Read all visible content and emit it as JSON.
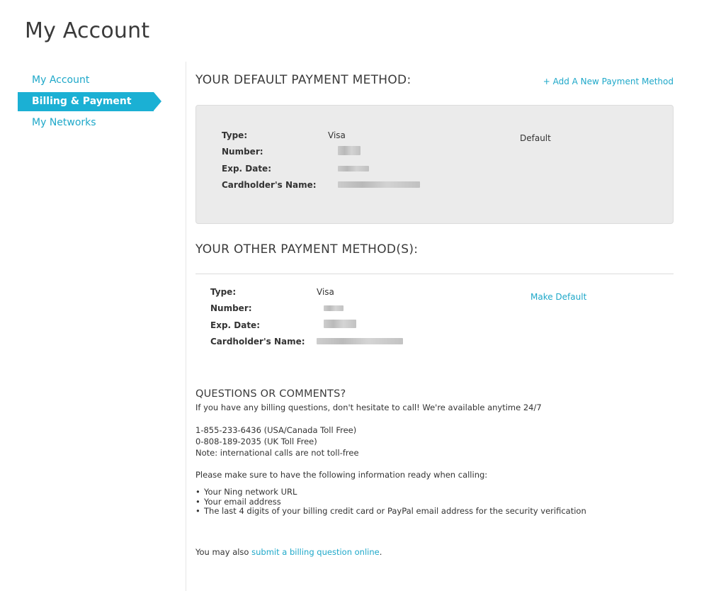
{
  "page": {
    "title": "My Account"
  },
  "sidebar": {
    "items": [
      {
        "label": "My Account",
        "active": false
      },
      {
        "label": "Billing & Payment",
        "active": true
      },
      {
        "label": "My Networks",
        "active": false
      }
    ]
  },
  "default_payment": {
    "heading": "YOUR DEFAULT PAYMENT METHOD:",
    "add_link": "+ Add A New Payment Method",
    "status": "Default",
    "fields": {
      "type_label": "Type:",
      "type_value": "Visa",
      "number_label": "Number:",
      "exp_label": "Exp. Date:",
      "name_label": "Cardholder's Name:"
    }
  },
  "other_payment": {
    "heading": "YOUR OTHER PAYMENT METHOD(S):",
    "make_default": "Make Default",
    "fields": {
      "type_label": "Type:",
      "type_value": "Visa",
      "number_label": "Number:",
      "exp_label": "Exp. Date:",
      "name_label": "Cardholder's Name:"
    }
  },
  "questions": {
    "title": "QUESTIONS OR COMMENTS?",
    "intro": "If you have any billing questions, don't hesitate to call! We're available anytime 24/7",
    "phone_us": "1-855-233-6436 (USA/Canada Toll Free)",
    "phone_uk": "0-808-189-2035 (UK Toll Free)",
    "note": "Note: international calls are not toll-free",
    "prepare": "Please make sure to have the following information ready when calling:",
    "list": [
      "Your Ning network URL",
      "Your email address",
      "The last 4 digits of your billing credit card or PayPal email address for the security verification"
    ],
    "online_prefix": "You may also ",
    "online_link": "submit a billing question online",
    "online_suffix": "."
  }
}
